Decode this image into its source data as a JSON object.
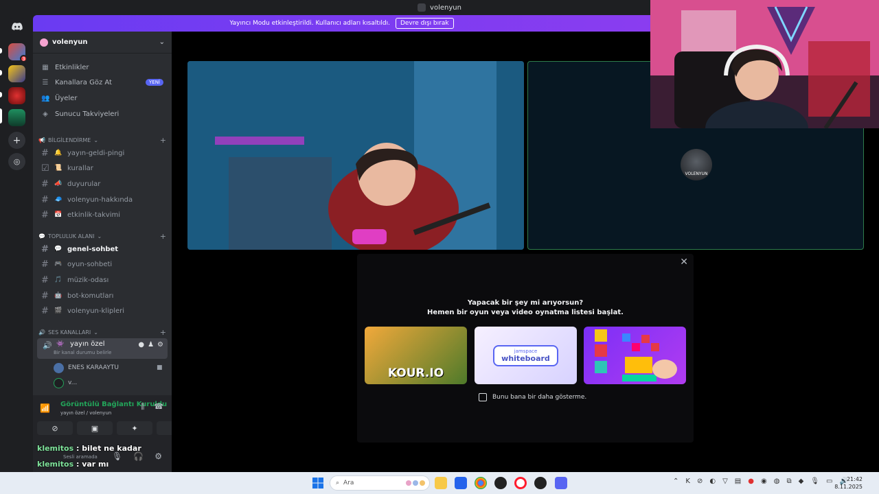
{
  "window": {
    "title": "volenyun"
  },
  "banner": {
    "text": "Yayıncı Modu etkinleştirildi. Kullanıcı adları kısaltıldı.",
    "button": "Devre dışı bırak"
  },
  "rail": {
    "badge_count": "3"
  },
  "guild": {
    "name": "volenyun"
  },
  "nav": {
    "events": "Etkinlikler",
    "browse": "Kanallara Göz At",
    "browse_badge": "YENİ",
    "members": "Üyeler",
    "boosts": "Sunucu Takviyeleri"
  },
  "categories": {
    "info": "BİLGİLENDİRME",
    "community": "TOPLULUK ALANI",
    "voice": "SES KANALLARI"
  },
  "info_channels": [
    {
      "emoji": "🔔",
      "name": "yayın-geldi-pingi"
    },
    {
      "emoji": "📜",
      "name": "kurallar"
    },
    {
      "emoji": "📣",
      "name": "duyurular"
    },
    {
      "emoji": "🧢",
      "name": "volenyun-hakkında"
    },
    {
      "emoji": "📅",
      "name": "etkinlik-takvimi"
    }
  ],
  "community_channels": [
    {
      "emoji": "💬",
      "name": "genel-sohbet"
    },
    {
      "emoji": "🎮",
      "name": "oyun-sohbeti"
    },
    {
      "emoji": "🎵",
      "name": "müzik-odası"
    },
    {
      "emoji": "🤖",
      "name": "bot-komutları"
    },
    {
      "emoji": "🎬",
      "name": "volenyun-klipleri"
    }
  ],
  "voice_channel": {
    "name": "yayın özel",
    "status": "Bir kanal durumu belirle"
  },
  "voice_members": [
    "ENES KARAAYTU",
    "v..."
  ],
  "voice_panel": {
    "status": "Görüntülü Bağlantı Kuruldu",
    "sub": "yayın özel / volenyun",
    "user_status": "Sesli aramada"
  },
  "chat": [
    {
      "user": "klemitos",
      "text": " : bilet ne kadar"
    },
    {
      "user": "klemitos",
      "text": " : var mı"
    }
  ],
  "modal": {
    "line1": "Yapacak bir şey mi arıyorsun?",
    "line2": "Hemen bir oyun veya video oynatma listesi başlat.",
    "cards": [
      "KOUR.IO",
      "whiteboard",
      ""
    ],
    "card2_top": "jamspace",
    "checkbox": "Bunu bana bir daha gösterme."
  },
  "tile2": {
    "avatar_label": "VOLENYUN"
  },
  "taskbar": {
    "search": "Ara",
    "time": "21:42",
    "date": "8.11.2025"
  },
  "colors": {
    "accent": "#5865f2",
    "online": "#23a55a",
    "banner": "#7a3df1"
  }
}
